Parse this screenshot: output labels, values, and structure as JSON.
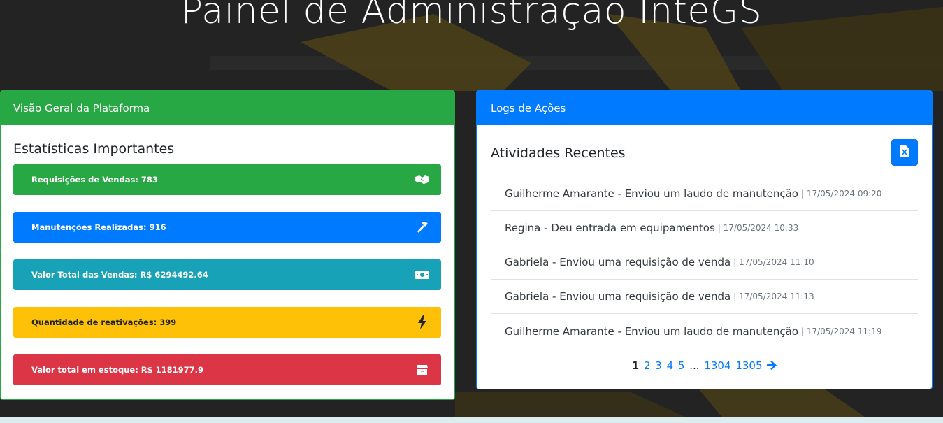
{
  "page": {
    "title": "Painel de Administração InteGS"
  },
  "overview": {
    "header": "Visão Geral da Plataforma",
    "section_title": "Estatísticas Importantes",
    "stats": [
      {
        "label": "Requisições de Vendas: 783",
        "icon": "handshake-icon",
        "color": "#28a745"
      },
      {
        "label": "Manutenções Realizadas: 916",
        "icon": "hammer-icon",
        "color": "#007bff"
      },
      {
        "label": "Valor Total das Vendas: R$ 6294492.64",
        "icon": "money-bill-icon",
        "color": "#17a2b8"
      },
      {
        "label": "Quantidade de reativações: 399",
        "icon": "bolt-icon",
        "color": "#ffc107"
      },
      {
        "label": "Valor total em estoque: R$ 1181977.9",
        "icon": "box-icon",
        "color": "#dc3545"
      }
    ]
  },
  "logs": {
    "header": "Logs de Ações",
    "section_title": "Atividades Recentes",
    "export_icon": "file-excel-icon",
    "items": [
      {
        "text": "Guilherme Amarante - Enviou um laudo de manutenção",
        "timestamp": "| 17/05/2024 09:20"
      },
      {
        "text": "Regina - Deu entrada em equipamentos",
        "timestamp": "| 17/05/2024 10:33"
      },
      {
        "text": "Gabriela - Enviou uma requisição de venda",
        "timestamp": "| 17/05/2024 11:10"
      },
      {
        "text": "Gabriela - Enviou uma requisição de venda",
        "timestamp": "| 17/05/2024 11:13"
      },
      {
        "text": "Guilherme Amarante - Enviou um laudo de manutenção",
        "timestamp": "| 17/05/2024 11:19"
      }
    ],
    "pagination": {
      "current": "1",
      "pages": [
        "2",
        "3",
        "4",
        "5"
      ],
      "ellipsis": "...",
      "last_pages": [
        "1304",
        "1305"
      ],
      "next_icon": "arrow-right-icon"
    }
  },
  "colors": {
    "background": "#232323",
    "accent_gold": "#6b5a1e",
    "success": "#28a745",
    "primary": "#007bff"
  }
}
